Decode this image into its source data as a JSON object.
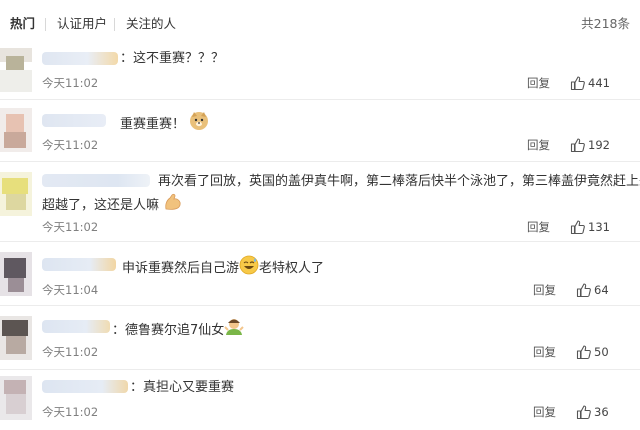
{
  "tabs": {
    "hot": "热门",
    "verified": "认证用户",
    "following": "关注的人"
  },
  "total_count": "共218条",
  "reply_label": "回复",
  "comments": [
    {
      "text": "这不重赛？？？",
      "time": "今天11:02",
      "likes": "441"
    },
    {
      "text": "重赛重赛！",
      "time": "今天11:02",
      "likes": "192"
    },
    {
      "text_line1": "再次看了回放，英国的盖伊真牛啊，第二棒落后快半个泳池了，第三棒盖伊竟然赶上来",
      "text_line2": "超越了，这还是人嘛",
      "time": "今天11:02",
      "likes": "131"
    },
    {
      "text_a": "申诉重赛然后自己游",
      "text_b": "老特权人了",
      "time": "今天11:04",
      "likes": "64"
    },
    {
      "text": "德鲁赛尔追7仙女",
      "time": "今天11:02",
      "likes": "50"
    },
    {
      "text": "真担心又要重赛",
      "time": "今天11:02",
      "likes": "36"
    }
  ],
  "emoji": [
    "doge-emoji",
    "flexed-biceps-emoji",
    "sweat-laugh-emoji",
    "shrug-emoji"
  ],
  "colors": {
    "text": "#333333",
    "muted": "#808080",
    "divider": "#ececec"
  }
}
